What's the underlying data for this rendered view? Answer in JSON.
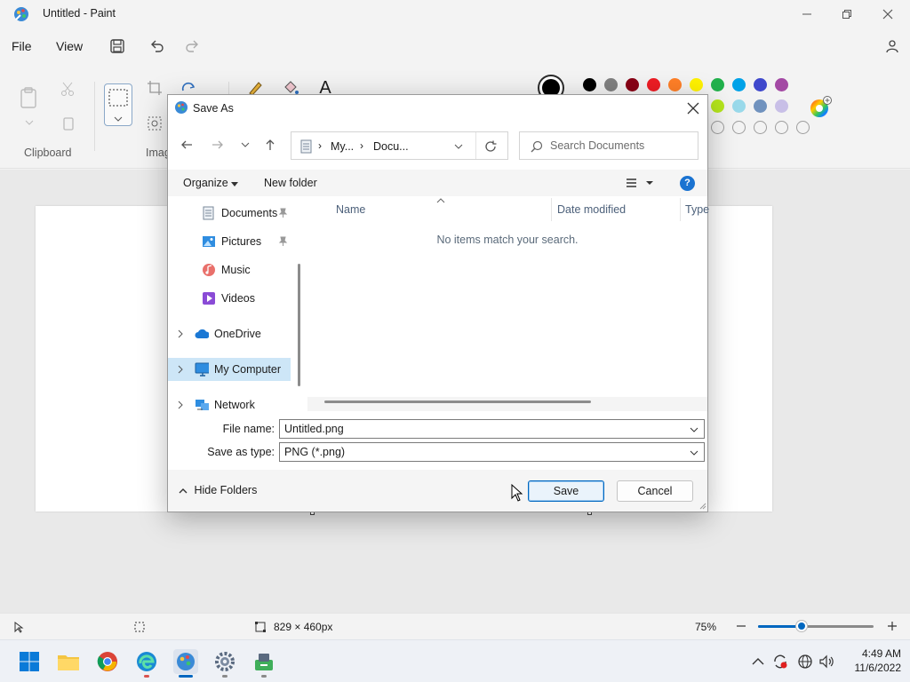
{
  "app": {
    "title": "Untitled - Paint"
  },
  "menu": {
    "file": "File",
    "view": "View"
  },
  "ribbon": {
    "clipboard_label": "Clipboard",
    "image_label": "Imag",
    "text_tool_glyph": "A"
  },
  "colors": {
    "row1": [
      "#000000",
      "#7f7f7f",
      "#880015",
      "#ed1c24",
      "#ff7f27",
      "#fff200",
      "#22b14c",
      "#00a2e8",
      "#3f48cc",
      "#a349a4"
    ],
    "row2": [
      "#b5e61d",
      "#99d9ea",
      "#7092be",
      "#c8bfe7"
    ],
    "row3": [
      "",
      "",
      "",
      "",
      ""
    ]
  },
  "dialog": {
    "title": "Save As",
    "breadcrumb": {
      "root": "My...",
      "folder": "Docu..."
    },
    "search_placeholder": "Search Documents",
    "toolbar": {
      "organize": "Organize",
      "new_folder": "New folder"
    },
    "nav_items": [
      {
        "label": "Documents",
        "pinned": true
      },
      {
        "label": "Pictures",
        "pinned": true
      },
      {
        "label": "Music"
      },
      {
        "label": "Videos"
      },
      {
        "label": "OneDrive"
      },
      {
        "label": "My Computer"
      },
      {
        "label": "Network"
      }
    ],
    "columns": {
      "name": "Name",
      "date": "Date modified",
      "type": "Type"
    },
    "empty_message": "No items match your search.",
    "file_name_label": "File name:",
    "file_name": "Untitled.png",
    "type_label": "Save as type:",
    "file_type": "PNG (*.png)",
    "hide_folders": "Hide Folders",
    "save": "Save",
    "cancel": "Cancel"
  },
  "status": {
    "dimensions": "829 × 460px",
    "zoom": "75%",
    "zoom_level": 0.38
  },
  "taskbar": {
    "time": "4:49 AM",
    "date": "11/6/2022"
  }
}
